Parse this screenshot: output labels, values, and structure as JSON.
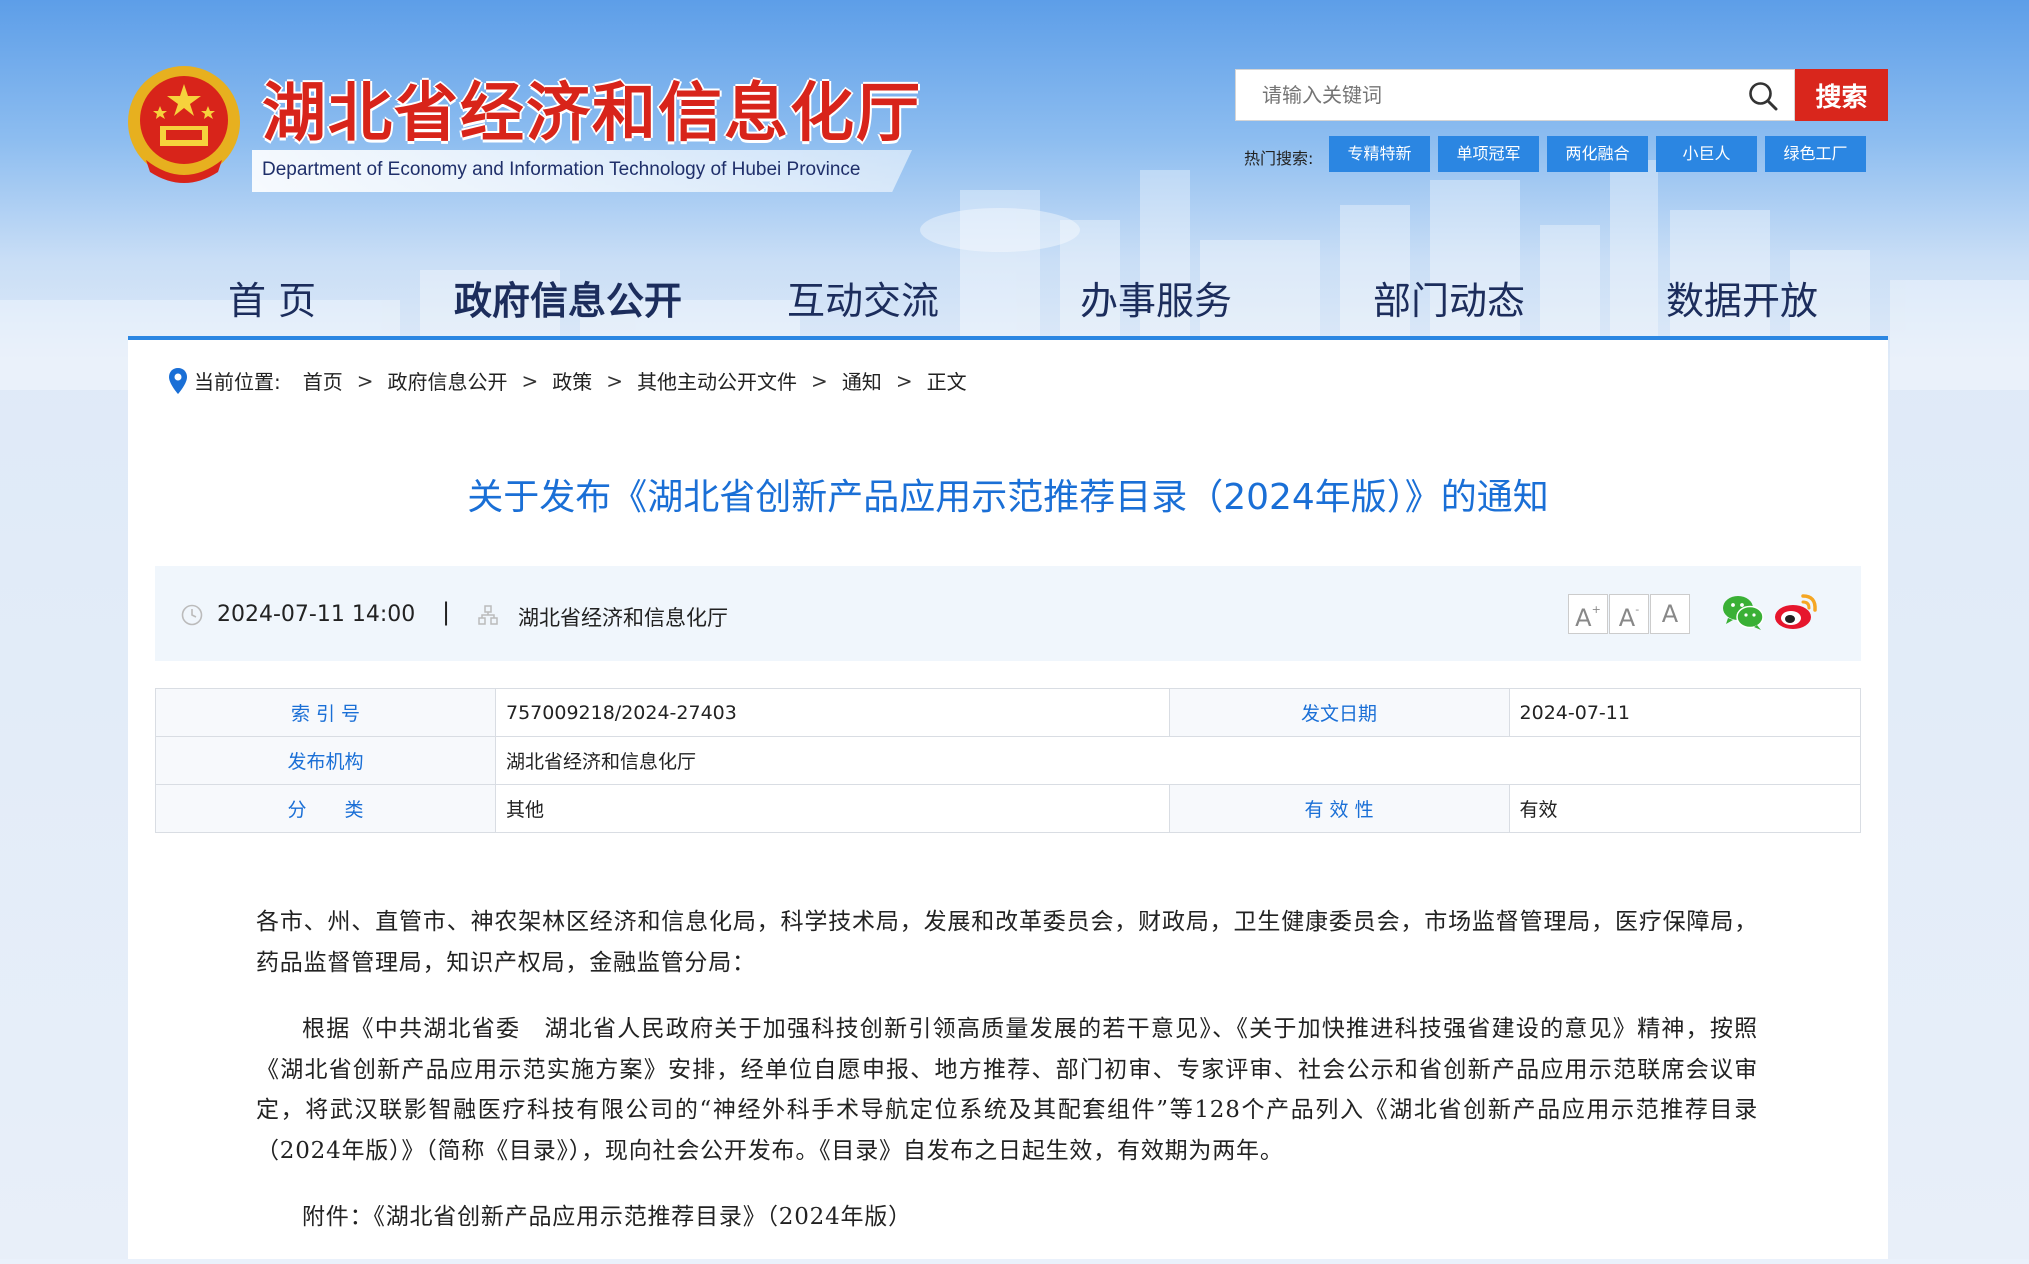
{
  "header": {
    "site_title": "湖北省经济和信息化厅",
    "site_subtitle": "Department of Economy and Information Technology of Hubei Province"
  },
  "search": {
    "placeholder": "请输入关键词",
    "button_label": "搜索",
    "hot_label": "热门搜索:",
    "hot_tags": [
      "专精特新",
      "单项冠军",
      "两化融合",
      "小巨人",
      "绿色工厂"
    ]
  },
  "nav": {
    "items": [
      "首 页",
      "政府信息公开",
      "互动交流",
      "办事服务",
      "部门动态",
      "数据开放"
    ],
    "active": "政府信息公开"
  },
  "breadcrumb": {
    "label": "当前位置:",
    "items": [
      "首页",
      "政府信息公开",
      "政策",
      "其他主动公开文件",
      "通知",
      "正文"
    ],
    "separator": ">"
  },
  "article": {
    "title": "关于发布《湖北省创新产品应用示范推荐目录（2024年版）》的通知",
    "datetime": "2024-07-11 14:00",
    "meta_separator": "|",
    "source": "湖北省经济和信息化厅",
    "font_buttons": [
      "A",
      "A",
      "A"
    ],
    "info": {
      "index_label": "索 引 号",
      "index_value": "757009218/2024-27403",
      "date_label": "发文日期",
      "date_value": "2024-07-11",
      "org_label": "发布机构",
      "org_value": "湖北省经济和信息化厅",
      "category_label": "分　　类",
      "category_value": "其他",
      "validity_label": "有 效 性",
      "validity_value": "有效"
    },
    "paragraphs": [
      "各市、州、直管市、神农架林区经济和信息化局，科学技术局，发展和改革委员会，财政局，卫生健康委员会，市场监督管理局，医疗保障局，药品监督管理局，知识产权局，金融监管分局：",
      "根据《中共湖北省委　湖北省人民政府关于加强科技创新引领高质量发展的若干意见》、《关于加快推进科技强省建设的意见》精神，按照《湖北省创新产品应用示范实施方案》安排，经单位自愿申报、地方推荐、部门初审、专家评审、社会公示和省创新产品应用示范联席会议审定，将武汉联影智融医疗科技有限公司的“神经外科手术导航定位系统及其配套组件”等128个产品列入《湖北省创新产品应用示范推荐目录（2024年版）》（简称《目录》），现向社会公开发布。《目录》自发布之日起生效，有效期为两年。",
      "附件：《湖北省创新产品应用示范推荐目录》（2024年版）"
    ]
  },
  "colors": {
    "brand_red": "#d8241a",
    "accent_blue": "#2b86e2",
    "title_blue": "#1a6fd6",
    "nav_text": "#1c2d5c"
  }
}
